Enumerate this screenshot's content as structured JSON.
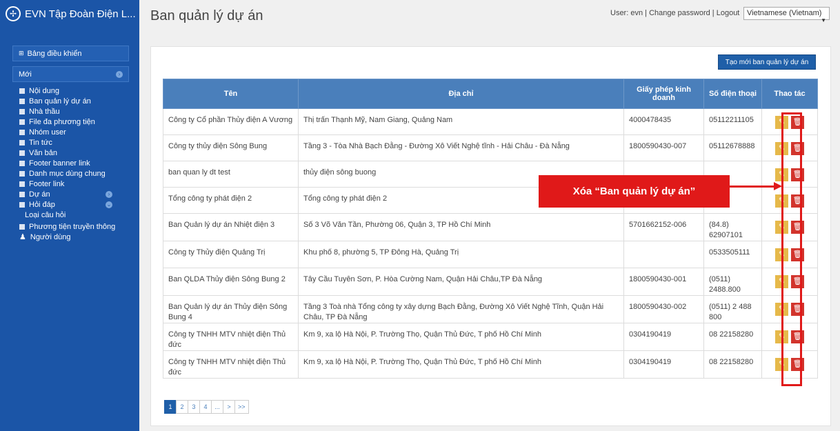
{
  "app": {
    "title": "EVN Tập Đoàn Điện L...",
    "logo_icon": "evn-logo-icon"
  },
  "sidebar": {
    "dashboard": "Bảng điều khiển",
    "new_section": "Mới",
    "items": [
      {
        "label": "Nội dung"
      },
      {
        "label": "Ban quản lý dự án"
      },
      {
        "label": "Nhà thầu"
      },
      {
        "label": "File đa phương tiện"
      },
      {
        "label": "Nhóm user"
      },
      {
        "label": "Tin tức"
      },
      {
        "label": "Văn bản"
      },
      {
        "label": "Footer banner link"
      },
      {
        "label": "Danh mục dùng chung"
      },
      {
        "label": "Footer link"
      },
      {
        "label": "Dự án"
      },
      {
        "label": "Hỏi đáp"
      },
      {
        "label": "Loại câu hỏi"
      },
      {
        "label": "Phương tiện truyền thông"
      },
      {
        "label": "Người dùng"
      }
    ]
  },
  "header": {
    "page_title": "Ban quản lý dự án",
    "user": "User: evn",
    "change_password": "Change password",
    "logout": "Logout",
    "separator": "|",
    "language": "Vietnamese (Vietnam)"
  },
  "toolbar": {
    "create_label": "Tạo mới ban quản lý dự án"
  },
  "table": {
    "headers": [
      "Tên",
      "Địa chỉ",
      "Giấy phép kinh doanh",
      "Số điện thoại",
      "Thao tác"
    ],
    "rows": [
      {
        "name": "Công ty Cổ phần Thủy điện A Vương",
        "address": "Thị trấn Thạnh Mỹ, Nam Giang, Quảng Nam",
        "license": "4000478435",
        "phone": "05112211105"
      },
      {
        "name": "Công ty thủy điện Sông Bung",
        "address": "Tầng 3 - Tòa Nhà Bạch Đằng - Đường Xô Viết Nghệ tĩnh - Hải Châu - Đà Nẵng",
        "license": "1800590430-007",
        "phone": "05112678888"
      },
      {
        "name": "ban quan ly dt test",
        "address": "thủy điện sông buong",
        "license": "",
        "phone": ""
      },
      {
        "name": "Tổng công ty phát điện 2",
        "address": "Tổng công ty phát điện 2",
        "license": "",
        "phone": ""
      },
      {
        "name": "Ban Quản lý dự án Nhiệt điện 3",
        "address": "Số 3 Võ Văn Tần, Phường 06, Quận 3, TP Hồ Chí Minh",
        "license": "5701662152-006",
        "phone": "(84.8) 62907101"
      },
      {
        "name": "Công ty Thủy điện Quảng Trị",
        "address": "Khu phố 8, phường 5, TP Đông Hà, Quảng Trị",
        "license": "",
        "phone": "0533505111"
      },
      {
        "name": "Ban QLDA Thủy điện Sông Bung 2",
        "address": "Tây Cầu Tuyên Sơn, P. Hòa Cường Nam, Quận Hải Châu,TP Đà Nẵng",
        "license": "1800590430-001",
        "phone": "(0511) 2488.800"
      },
      {
        "name": "Ban Quản lý dự án Thủy điện Sông Bung 4",
        "address": "Tầng 3 Toà nhà Tổng công ty xây dựng Bạch Đằng, Đường Xô Viết Nghệ Tĩnh, Quận Hải Châu, TP Đà Nẵng",
        "license": "1800590430-002",
        "phone": "(0511) 2 488 800"
      },
      {
        "name": "Công ty TNHH MTV nhiệt điện Thủ đức",
        "address": "Km 9, xa lộ Hà Nội, P. Trường Thọ, Quận Thủ Đức, T phố Hồ Chí Minh",
        "license": "0304190419",
        "phone": "08 22158280"
      },
      {
        "name": "Công ty TNHH MTV nhiệt điện Thủ đức",
        "address": "Km 9, xa lộ Hà Nội, P. Trường Thọ, Quận Thủ Đức, T phố Hồ Chí Minh",
        "license": "0304190419",
        "phone": "08 22158280"
      }
    ]
  },
  "annotation": {
    "callout_text": "Xóa “Ban quản lý dự án”",
    "color": "#e01919"
  },
  "pagination": {
    "pages": [
      "1",
      "2",
      "3",
      "4",
      "...",
      ">",
      ">>"
    ],
    "active": "1"
  },
  "colors": {
    "sidebar": "#1b55a7",
    "header_row": "#4a7fbb",
    "edit": "#e6b94a",
    "delete": "#d2342c"
  }
}
